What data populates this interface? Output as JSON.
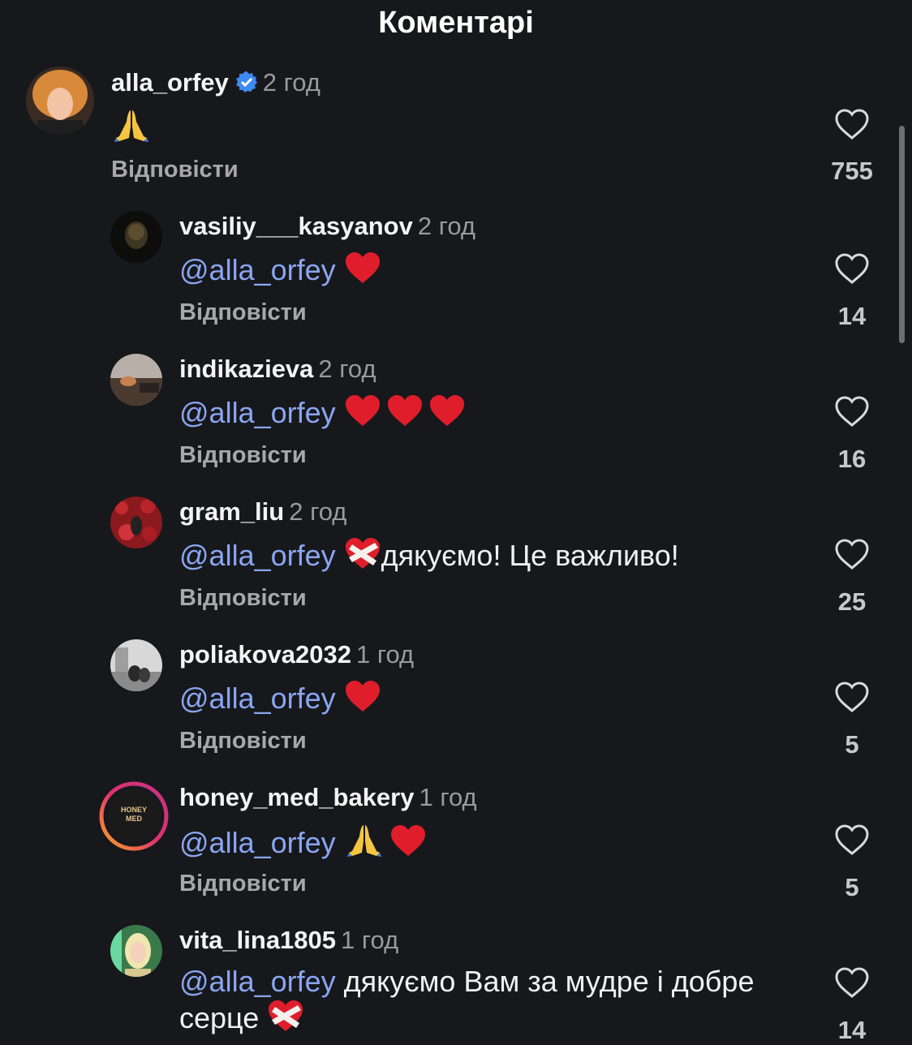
{
  "header": {
    "title": "Коментарі"
  },
  "comments": [
    {
      "username": "alla_orfey",
      "verified": true,
      "time": "2 год",
      "mention": "",
      "text": "",
      "emoji_icons": [
        "praying-hands-icon"
      ],
      "reply_label": "Відповісти",
      "likes": "755"
    },
    {
      "username": "vasiliy___kasyanov",
      "time": "2 год",
      "mention": "@alla_orfey",
      "text": "",
      "emoji_icons": [
        "red-heart-icon"
      ],
      "reply_label": "Відповісти",
      "likes": "14"
    },
    {
      "username": "indikazieva",
      "time": "2 год",
      "mention": "@alla_orfey",
      "text": "",
      "emoji_icons": [
        "red-heart-icon",
        "red-heart-icon",
        "red-heart-icon"
      ],
      "reply_label": "Відповісти",
      "likes": "16"
    },
    {
      "username": "gram_liu",
      "time": "2 год",
      "mention": "@alla_orfey",
      "text": "дякуємо! Це важливо!",
      "emoji_icons": [
        "mending-heart-icon"
      ],
      "reply_label": "Відповісти",
      "likes": "25"
    },
    {
      "username": "poliakova2032",
      "time": "1 год",
      "mention": "@alla_orfey",
      "text": "",
      "emoji_icons": [
        "red-heart-icon"
      ],
      "reply_label": "Відповісти",
      "likes": "5"
    },
    {
      "username": "honey_med_bakery",
      "time": "1 год",
      "mention": "@alla_orfey",
      "text": "",
      "emoji_icons": [
        "praying-hands-icon",
        "red-heart-icon"
      ],
      "reply_label": "Відповісти",
      "likes": "5",
      "avatar_text": "HONEY MED"
    },
    {
      "username": "vita_lina1805",
      "time": "1 год",
      "mention": "@alla_orfey",
      "text": "дякуємо Вам за мудре і добре",
      "text_line2": "серце",
      "emoji_icons": [
        "mending-heart-icon"
      ],
      "reply_label": "",
      "likes": "14"
    }
  ],
  "colors": {
    "background": "#17181c",
    "mention": "#8aa6f2",
    "verified": "#3d8bf0",
    "heart": "#e01e2b"
  }
}
